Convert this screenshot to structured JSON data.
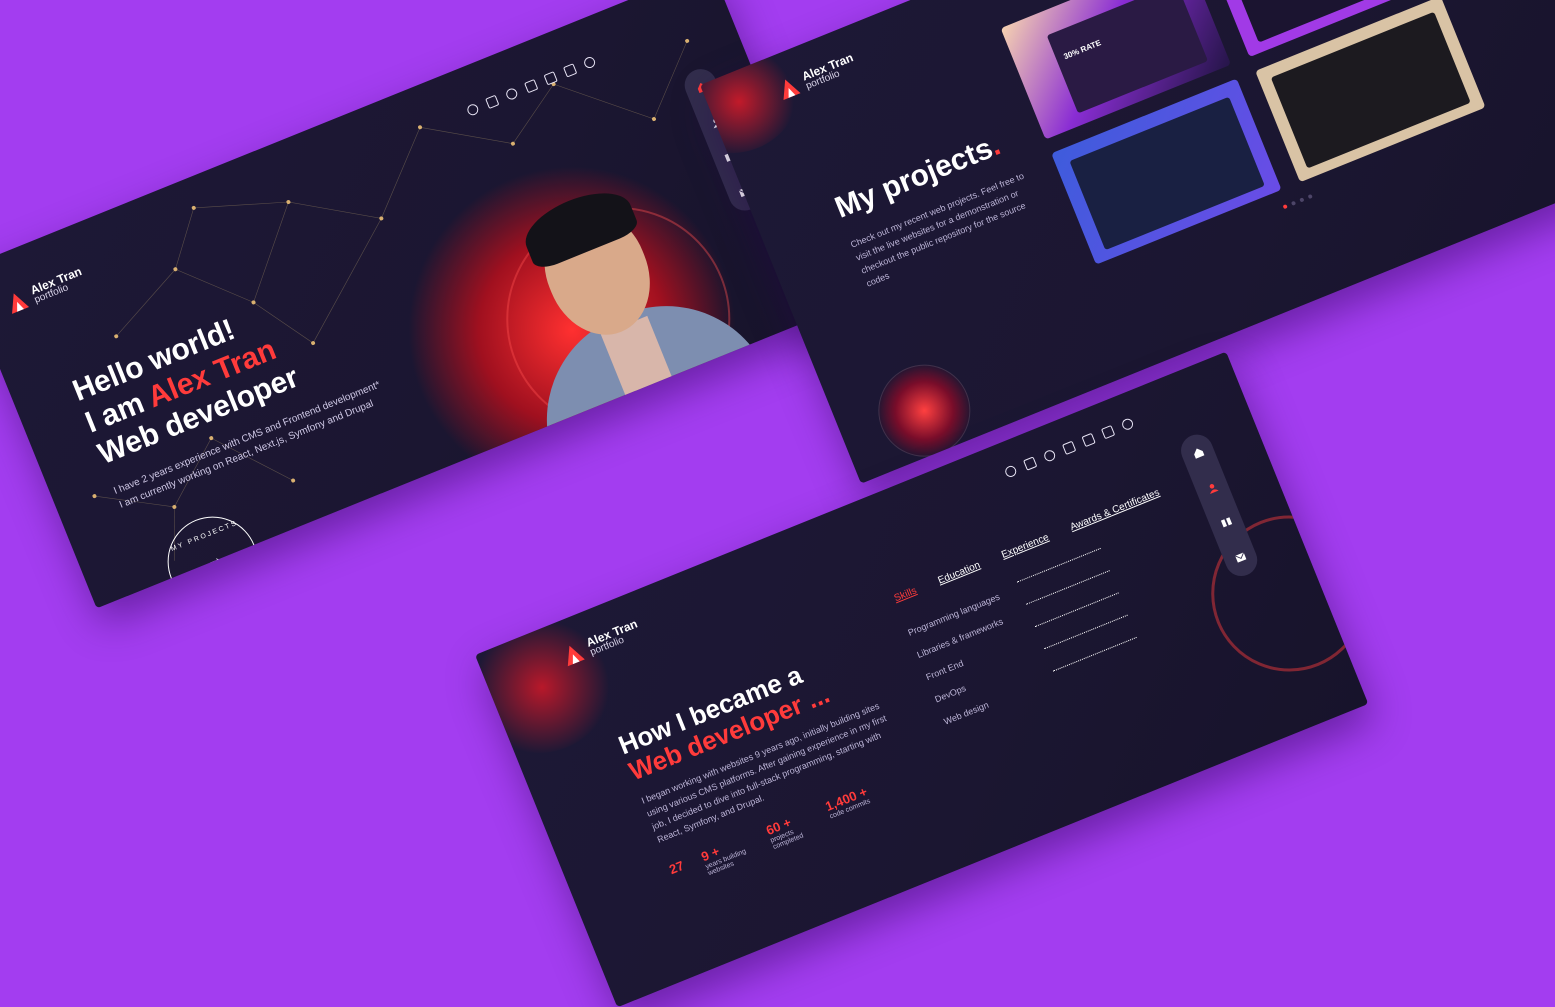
{
  "colors": {
    "background": "#a33df0",
    "panel": "#1d1836",
    "accent": "#ff3b3b",
    "nav": "#322d4c"
  },
  "brand": {
    "name": "Alex Tran",
    "subtitle": "portfolio"
  },
  "social_icons": [
    "github-icon",
    "linkedin-icon",
    "codepen-icon",
    "instagram-icon",
    "behance-icon",
    "dribbble-icon",
    "dribbble-alt-icon"
  ],
  "nav_icons": [
    "home-icon",
    "user-icon",
    "projects-icon",
    "mail-icon"
  ],
  "hero": {
    "line1": "Hello world!",
    "line2_prefix": "I am ",
    "line2_name": "Alex Tran",
    "line3": "Web developer",
    "desc1": "I have 2 years experience with CMS and Frontend development*",
    "desc2": "I am currently working on React, Next.js, Symfony and Drupal",
    "projects_badge_top": "MY PROJECTS",
    "projects_badge_bottom": "MY PROJECTS",
    "arrow": "→"
  },
  "projects": {
    "title": "My projects",
    "dot": ".",
    "desc": "Check out my recent web projects. Feel free to visit the live websites for a demonstration or checkout the public repository for the source codes",
    "card1_title": "30% RATE"
  },
  "about": {
    "title1": "How I became a",
    "title2": "Web developer ...",
    "desc": "I began working with websites 9 years ago, initially building sites using various CMS platforms. After gaining experience in my first job, I decided to dive into full-stack programming, starting with React, Symfony, and Drupal.",
    "tabs": [
      {
        "label": "Skills"
      },
      {
        "label": "Education"
      },
      {
        "label": "Experience"
      },
      {
        "label": "Awards & Certificates"
      }
    ],
    "skills": [
      {
        "label": "Programming languages"
      },
      {
        "label": "Libraries & frameworks"
      },
      {
        "label": "Front End"
      },
      {
        "label": "DevOps"
      },
      {
        "label": "Web design"
      }
    ],
    "stats": [
      {
        "value": "27",
        "label": ""
      },
      {
        "value": "9 +",
        "label": "years building websites"
      },
      {
        "value": "60 +",
        "label": "projects completed"
      },
      {
        "value": "1,400 +",
        "label": "code commits"
      }
    ]
  }
}
